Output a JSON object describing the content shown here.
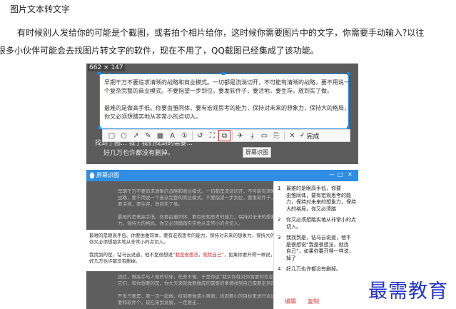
{
  "article": {
    "title": "图片文本转文字",
    "para1": "有时候别人发给你的可能是个截图，或者拍个相片给你，这时候你需要图片中的文字，你需要手动输入?以往",
    "para2": "很多小伙伴可能会去找图片转文字的软件，现在不用了，QQ截图已经集成了该功能。"
  },
  "screenshot1": {
    "dimensions": "662 × 147",
    "sel_lines": [
      "早期干万不要追求清晰的战略和商业模式。一切都是流淌切开，不可能有清晰的战略，要不用说一",
      "个复杂完整的商业模式。不要指望一步到位，要发软件子，要活地，要生存，放到实了做。",
      "",
      "最难的是做高手低。你要由雏同体，要有宏观思考的能力，保持对未来的想象力，保持大的格局，",
      "你又必须想踏实地从非常小的点切入。"
    ],
    "sel_bold_label": "最难的是眼高手低",
    "behind_line1": "找到了图... 我了我们找到的需要...",
    "behind_line2": "好几万也许都没有删掉。",
    "toolbar": {
      "items": [
        {
          "name": "rect-icon",
          "glyph": "□"
        },
        {
          "name": "ellipse-icon",
          "glyph": "○"
        },
        {
          "name": "arrow-icon",
          "glyph": "↗"
        },
        {
          "name": "pen-icon",
          "glyph": "✎"
        },
        {
          "name": "mosaic-icon",
          "glyph": "▦"
        },
        {
          "name": "text-icon",
          "glyph": "A"
        },
        {
          "name": "number-icon",
          "glyph": "①"
        },
        {
          "name": "undo-icon",
          "glyph": "↺"
        },
        {
          "name": "screenshot-icon",
          "glyph": "⛶"
        },
        {
          "name": "ocr-icon",
          "glyph": "⧉"
        },
        {
          "name": "pin-icon",
          "glyph": "✈"
        },
        {
          "name": "download-icon",
          "glyph": "⤓"
        },
        {
          "name": "save-icon",
          "glyph": "▭"
        },
        {
          "name": "share-icon",
          "glyph": "⎘"
        },
        {
          "name": "cancel-icon",
          "glyph": "✕"
        }
      ],
      "finish_label": "完成",
      "tooltip": "屏幕识图"
    }
  },
  "screenshot2": {
    "window_title": "屏幕识图",
    "left_dark_top": [
      "早期千万不要追求清晰的战略和商业模式。一切都是流淌切开，不可能有清晰的",
      "战略，要不用说一个复杂完整的商业模式。不要指望一步到位，要发软件子，",
      "要活地，要生存，放到实了做。",
      "",
      "最难的是做高手低，你要由雏同体，要有宏观思考的能力，保持对未来的想象",
      "力，保持大的格局，你又必须踏踏实实地从非常小的点切入。"
    ],
    "left_white": [
      "最难的是眼高手低。你要由雏同体，要有宏观思考的能力，保持对未来的想象力，保持大的格局，",
      "你又必须想踏实地从非常小的点切入。",
      "",
      "我找到的是，钻马云说道，他不是很想说“我是很想法，就找自己”，如果你要开得一样说，",
      "好几万也许都没有删掉。"
    ],
    "left_white_red": "“我是很想法，就找自己”",
    "left_dark_bottom": [
      "因此，做高手与人做的伙伴，任务不做，于是你这“我实你就对你需要的信息”，",
      "它们，和你想要的是，你大天来就做要做成的需要的事情找到自己需要走到的时候...",
      "",
      "开发只要是，第一次一起做，找到要做成小事情，找到要小的目标来进行合适的",
      "要和软件个，现在来到发展，一定要走..."
    ],
    "right_items": [
      [
        "最难的是眼高手低，你要",
        "由雏同体，要有宏观思考的能",
        "力，保持对未来的想象力，保持",
        "大的格局，你又必须踏"
      ],
      [
        "你又必须想踏实地从非常小的点",
        "切入。"
      ],
      [
        "我找到是，钻马云说道，他不",
        "是很想说“我是很想法，就找",
        "自己”，如果你要开得一样说，",
        "掉了"
      ],
      [
        "好几万也许都没有删掉。"
      ]
    ],
    "btn_edit": "编辑",
    "btn_copy": "复制"
  },
  "watermark": "最需教育"
}
